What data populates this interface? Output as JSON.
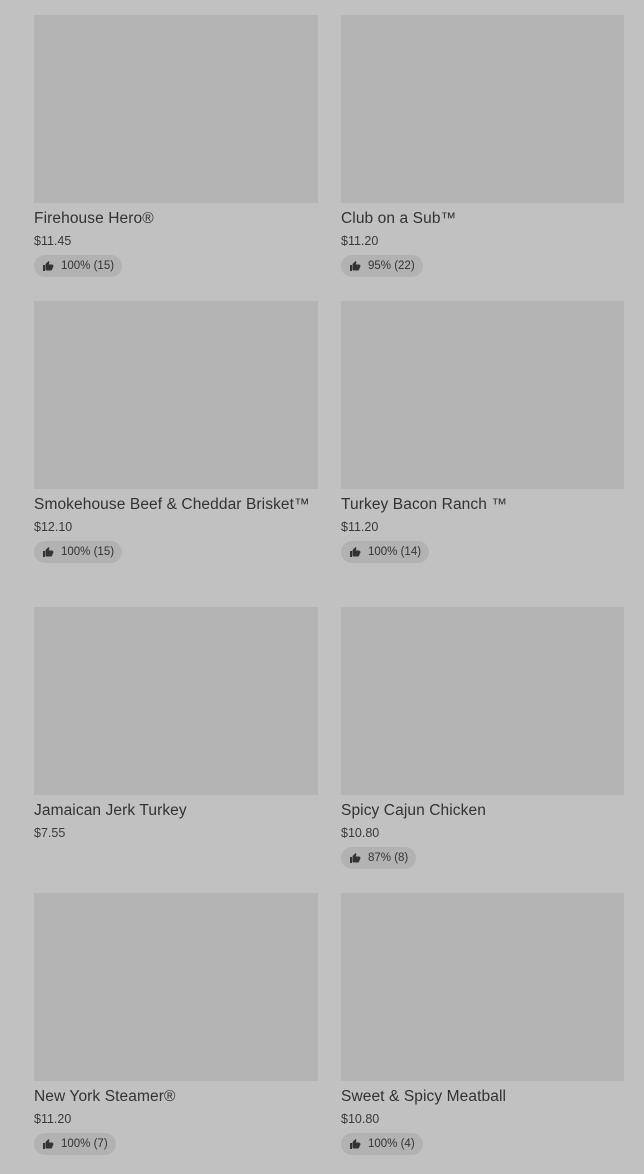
{
  "items": [
    {
      "name": "Firehouse Hero®",
      "price": "$11.45",
      "rating": "100% (15)"
    },
    {
      "name": "Club on a Sub™",
      "price": "$11.20",
      "rating": "95% (22)"
    },
    {
      "name": "Smokehouse Beef & Cheddar Brisket™",
      "price": "$12.10",
      "rating": "100% (15)"
    },
    {
      "name": "Turkey Bacon Ranch ™",
      "price": "$11.20",
      "rating": "100% (14)"
    },
    {
      "name": "Jamaican Jerk Turkey",
      "price": "$7.55",
      "rating": null
    },
    {
      "name": "Spicy Cajun Chicken",
      "price": "$10.80",
      "rating": "87% (8)"
    },
    {
      "name": "New York Steamer®",
      "price": "$11.20",
      "rating": "100% (7)"
    },
    {
      "name": "Sweet & Spicy Meatball",
      "price": "$10.80",
      "rating": "100% (4)"
    }
  ],
  "icons": {
    "rating": "thumbs-up-icon"
  },
  "colors": {
    "background": "#c1c1c1",
    "placeholder": "#b4b4b4",
    "badge": "#b2b2b2",
    "text": "#323232"
  }
}
